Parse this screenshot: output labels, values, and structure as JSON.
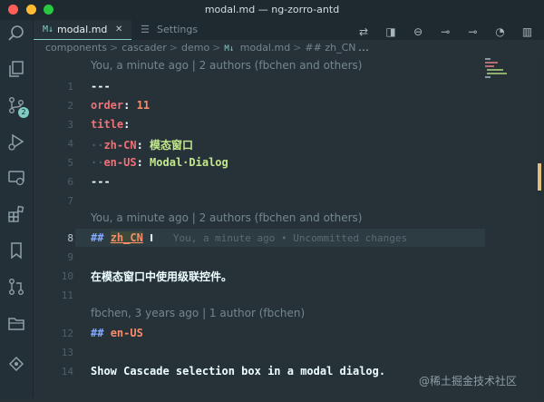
{
  "window": {
    "title": "modal.md — ng-zorro-antd",
    "traffic_lights": [
      "#ff5f57",
      "#febc2e",
      "#28c840"
    ]
  },
  "activity": {
    "scm_badge": "2"
  },
  "tabs": [
    {
      "label": "modal.md",
      "icon": "markdown-icon",
      "active": true,
      "close": "✕"
    },
    {
      "label": "Settings",
      "icon": "settings-icon",
      "active": false
    }
  ],
  "breadcrumb": {
    "parts": [
      "components",
      "cascader",
      "demo",
      "modal.md",
      "## zh_CN"
    ],
    "separator": ">",
    "md_icon": "M↓"
  },
  "editor": {
    "lens": [
      "You, a minute ago | 2 authors (fbchen and others)",
      "You, a minute ago | 2 authors (fbchen and others)",
      "fbchen, 3 years ago | 1 author (fbchen)"
    ],
    "line_numbers": [
      "1",
      "2",
      "3",
      "4",
      "5",
      "6",
      "7",
      "8",
      "9",
      "10",
      "11",
      "12",
      "13",
      "14"
    ],
    "current_line": "8",
    "lines": {
      "l1": "---",
      "l2_key": "order",
      "l2_colon": ":",
      "l2_val": "11",
      "l3_key": "title",
      "l3_colon": ":",
      "l4_indent": "··",
      "l4_key": "zh-CN",
      "l4_colon": ":",
      "l4_val": "模态窗口",
      "l5_indent": "··",
      "l5_key": "en-US",
      "l5_colon": ":",
      "l5_val": "Modal·Dialog",
      "l6": "---",
      "l8_hash": "##",
      "l8_text": "zh_CN",
      "l8_ghost": "You, a minute ago • Uncommitted changes",
      "l10": "在模态窗口中使用级联控件。",
      "l12_hash": "##",
      "l12_text": "en-US",
      "l14": "Show Cascade selection box in a modal dialog."
    }
  },
  "watermark": "@稀土掘金技术社区",
  "colors": {
    "accent": "#80cbc4",
    "background": "#263238",
    "scroll_marker": "#e0c080"
  }
}
